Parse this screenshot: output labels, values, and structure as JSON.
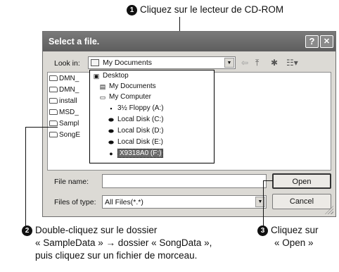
{
  "callouts": {
    "c1": {
      "num": "1",
      "text": "Cliquez sur le lecteur de CD-ROM"
    },
    "c2": {
      "num": "2",
      "line1": "Double-cliquez sur le dossier",
      "line2": "« SampleData » → dossier « SongData »,",
      "line3": "puis cliquez sur un fichier de morceau."
    },
    "c3": {
      "num": "3",
      "line1": "Cliquez sur",
      "line2": "« Open »"
    }
  },
  "dialog": {
    "title": "Select a file.",
    "help_btn": "?",
    "close_btn": "✕",
    "look_in_label": "Look in:",
    "look_in_value": "My Documents",
    "files": [
      "DMN_",
      "DMN_",
      "install",
      "MSD_",
      "Sampl",
      "SongE"
    ],
    "dropdown_items": [
      {
        "label": "Desktop",
        "icon": "desktop-icon"
      },
      {
        "label": "My Documents",
        "icon": "documents-icon"
      },
      {
        "label": "My Computer",
        "icon": "computer-icon"
      },
      {
        "label": "3½ Floppy (A:)",
        "icon": "floppy-icon"
      },
      {
        "label": "Local Disk (C:)",
        "icon": "disk-icon"
      },
      {
        "label": "Local Disk (D:)",
        "icon": "disk-icon"
      },
      {
        "label": "Local Disk (E:)",
        "icon": "disk-icon"
      },
      {
        "label": "X9318A0 (F:)",
        "icon": "cdrom-icon"
      }
    ],
    "file_name_label": "File name:",
    "file_name_value": "",
    "files_of_type_label": "Files of type:",
    "files_of_type_value": "All Files(*.*)",
    "open_btn": "Open",
    "cancel_btn": "Cancel"
  }
}
